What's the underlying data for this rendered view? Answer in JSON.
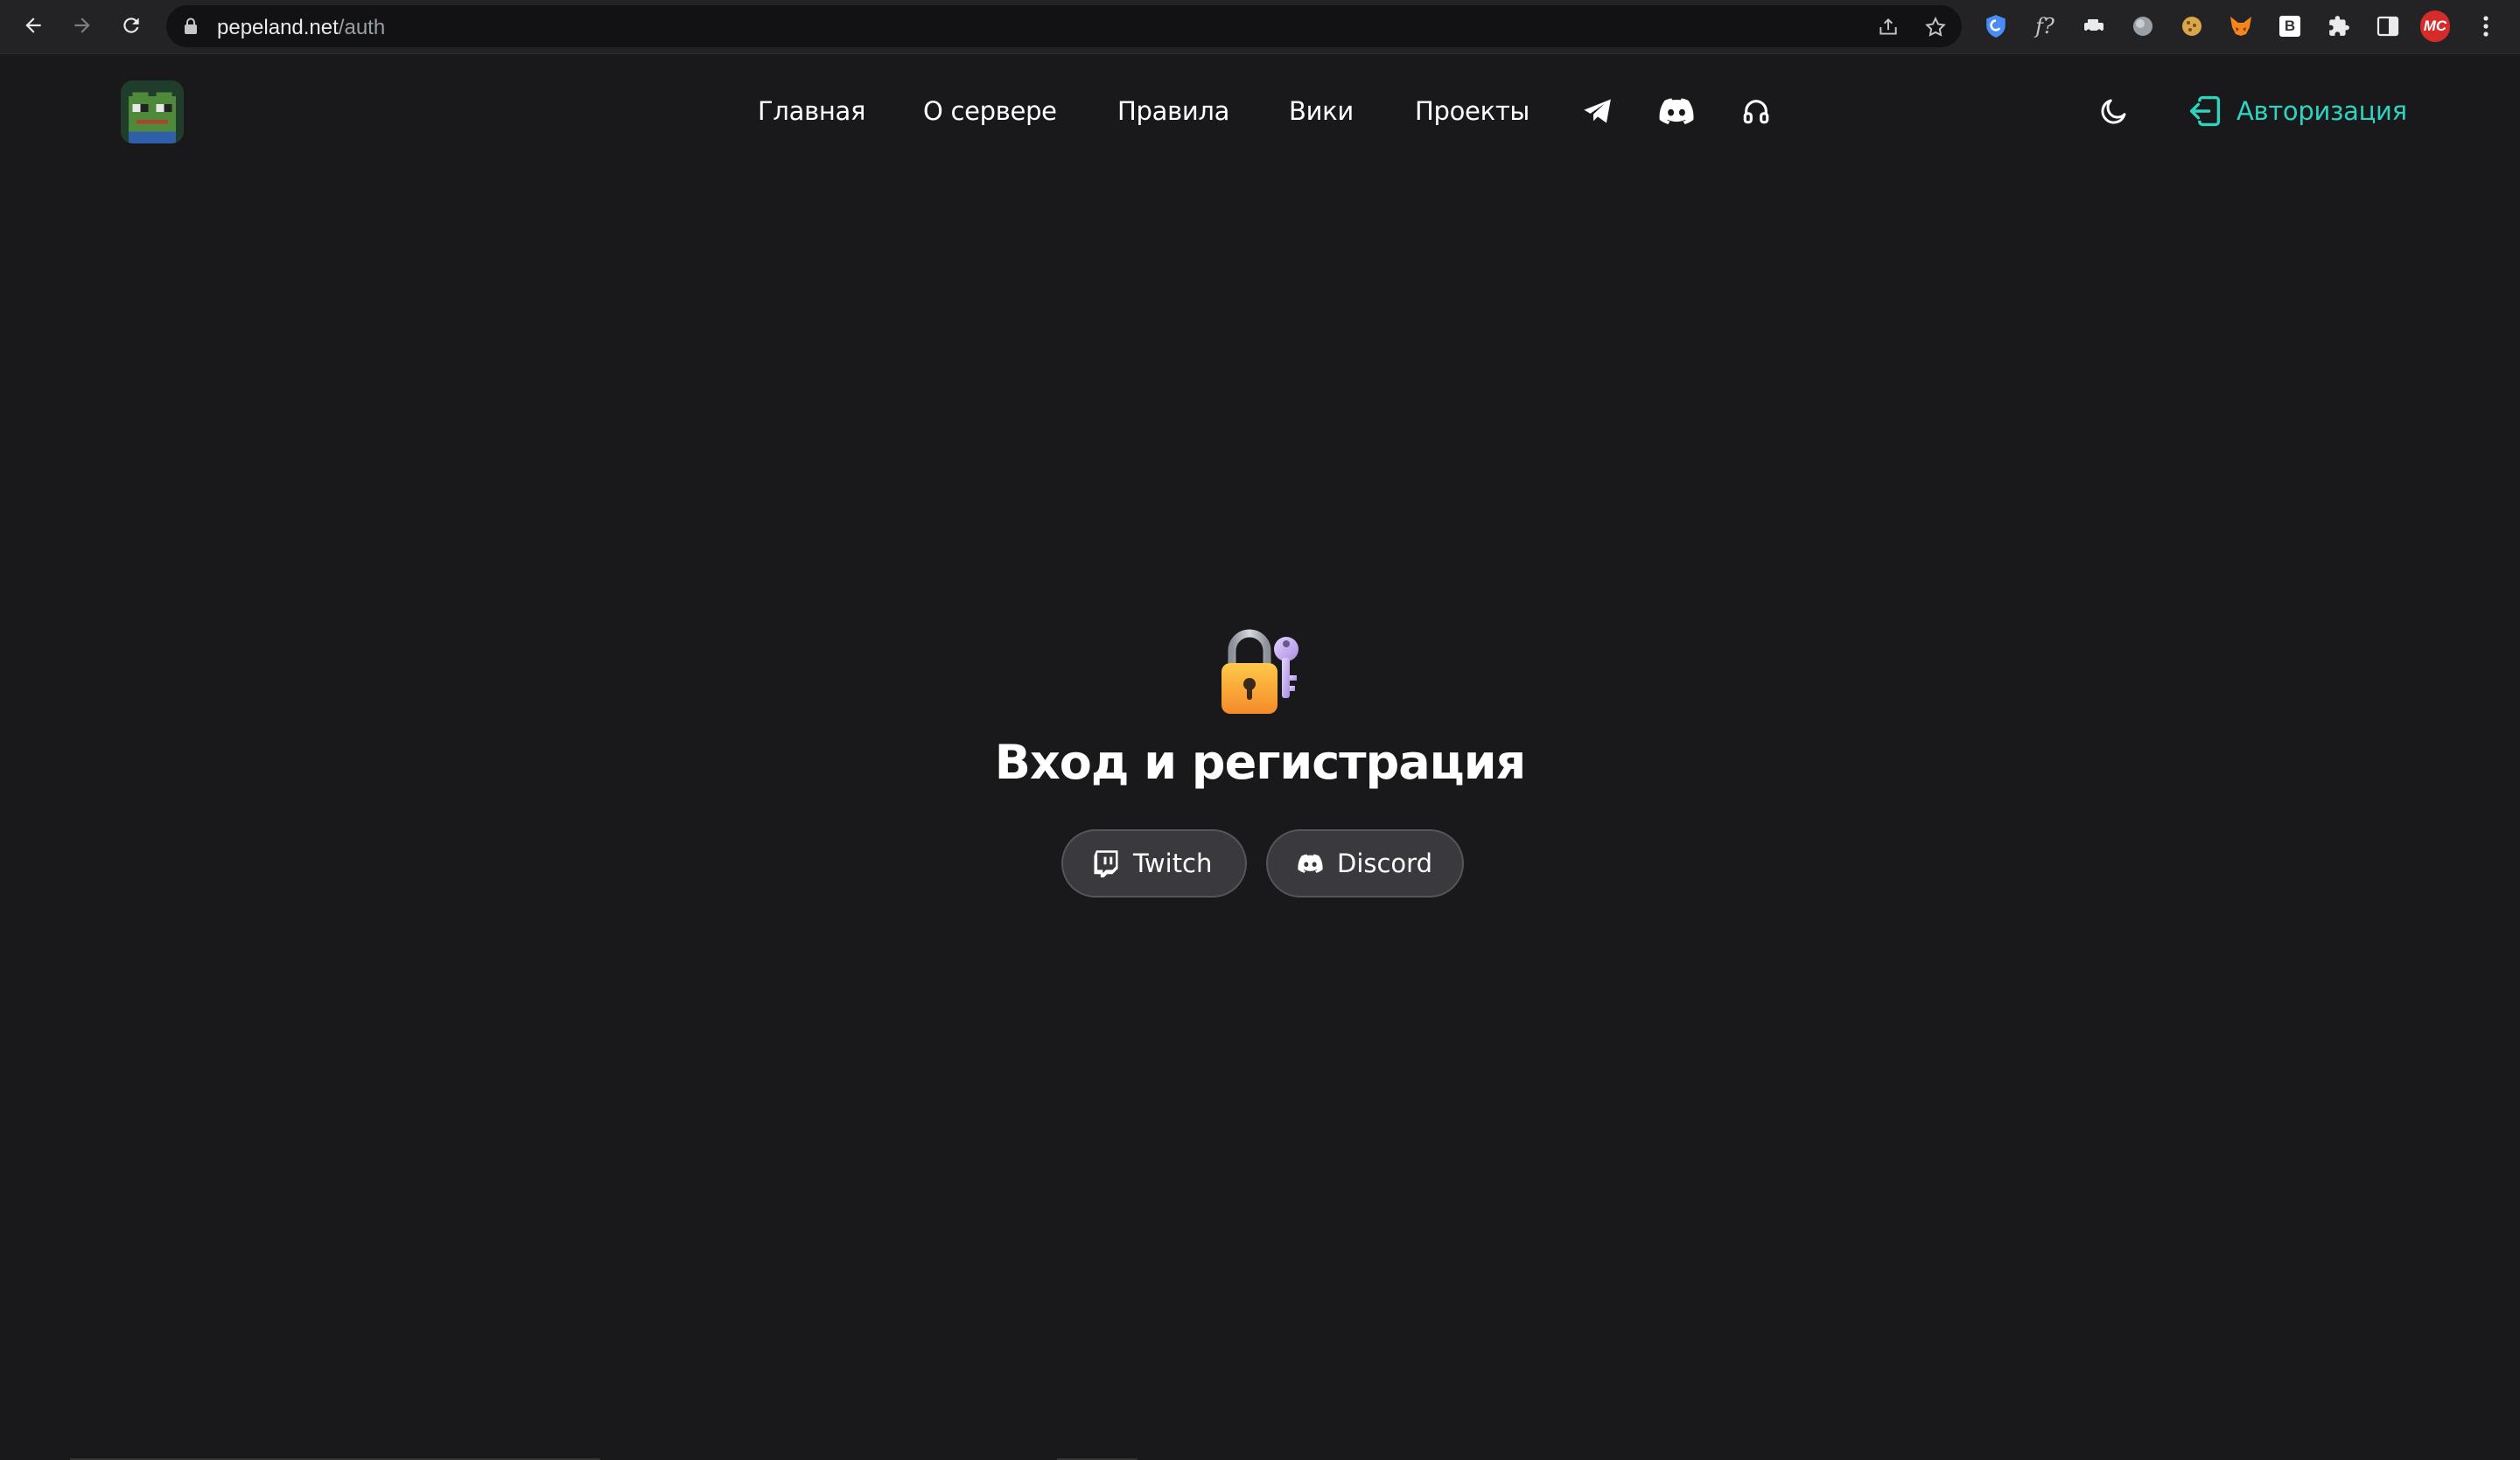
{
  "browser": {
    "url_host": "pepeland.net",
    "url_path": "/auth",
    "icons": {
      "back": "arrow-left-icon",
      "forward": "arrow-right-icon",
      "reload": "reload-icon",
      "lock": "lock-icon",
      "share": "share-icon",
      "bookmark": "star-icon",
      "menu": "kebab-menu-icon"
    },
    "extensions": [
      "shield-extension",
      "formula-extension",
      "car-extension",
      "circle-extension",
      "cookie-extension",
      "fox-extension",
      "b-extension",
      "puzzle-extension",
      "sidepanel-extension",
      "mc-extension"
    ],
    "mc_badge": "MC",
    "b_badge": "B"
  },
  "header": {
    "logo_icon": "pepe-logo",
    "nav": [
      {
        "label": "Главная"
      },
      {
        "label": "О сервере"
      },
      {
        "label": "Правила"
      },
      {
        "label": "Вики"
      },
      {
        "label": "Проекты"
      }
    ],
    "nav_icons": [
      "telegram-icon",
      "discord-icon",
      "headphones-icon"
    ],
    "theme_icon": "moon-icon",
    "auth": {
      "label": "Авторизация",
      "icon": "login-icon",
      "color": "#2dd4bf"
    }
  },
  "auth_page": {
    "emoji": "lock-with-key",
    "title": "Вход и регистрация",
    "providers": [
      {
        "label": "Twitch",
        "icon": "twitch-icon"
      },
      {
        "label": "Discord",
        "icon": "discord-icon"
      }
    ]
  },
  "colors": {
    "background": "#19191b",
    "accent": "#2dd4bf",
    "button_bg": "#3a3a3e"
  }
}
